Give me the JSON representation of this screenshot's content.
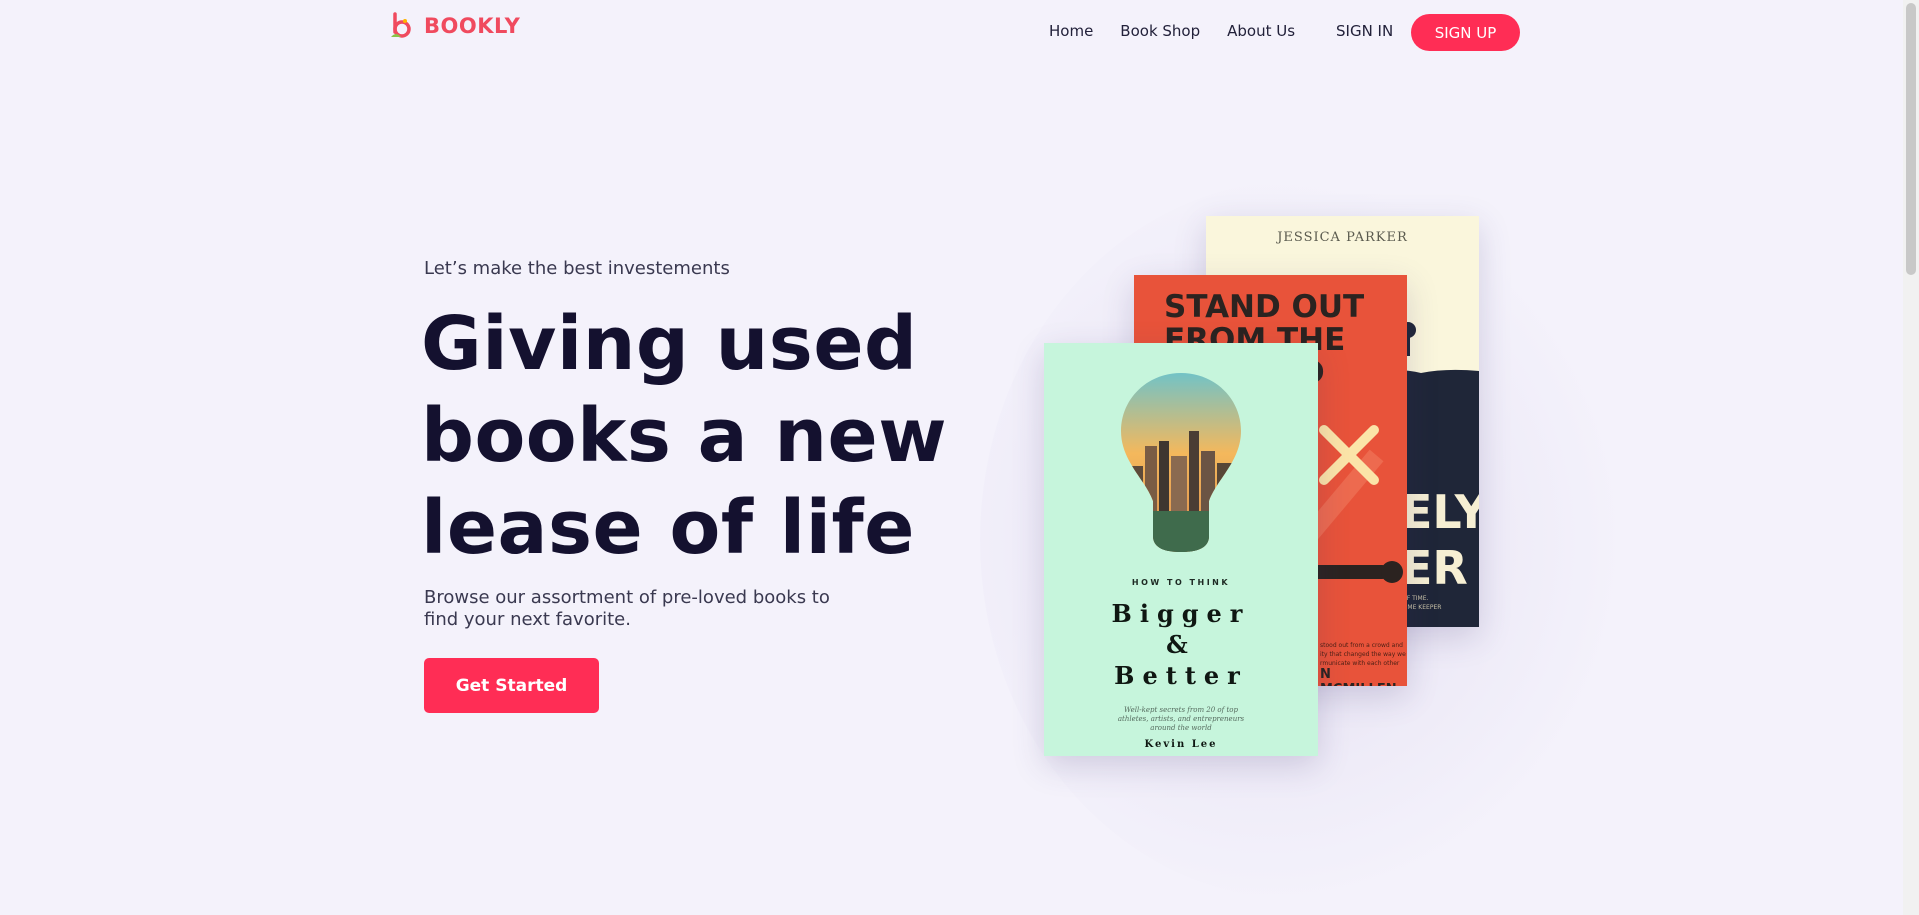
{
  "brand": {
    "name": "BOOKLY",
    "icon": "bookly-logo-icon"
  },
  "nav": {
    "links": [
      {
        "label": "Home"
      },
      {
        "label": "Book Shop"
      },
      {
        "label": "About Us"
      }
    ],
    "signin_label": "SIGN IN",
    "signup_label": "SIGN UP"
  },
  "hero": {
    "eyebrow": "Let’s make the best investements",
    "headline_lines": [
      "Giving used",
      "books a new",
      "lease of life"
    ],
    "subtext_lines": [
      "Browse our assortment of pre-loved books to",
      "find your next favorite."
    ],
    "cta_label": "Get Started"
  },
  "books": {
    "back": {
      "author": "JESSICA PARKER",
      "title_lines": [
        "ELY",
        "ER"
      ],
      "small_lines": [
        "OF TIME.",
        "TIME KEEPER"
      ]
    },
    "middle": {
      "title_lines": [
        "STAND OUT",
        "FROM THE",
        "D"
      ],
      "blurb_lines": [
        "stood out from a crowd and",
        "ity that changed the way we",
        "rmunicate with each other"
      ],
      "author": "N MCMILLEN"
    },
    "front": {
      "kicker": "HOW TO THINK",
      "title_lines": [
        "Bigger",
        "&",
        "Better"
      ],
      "tagline_lines": [
        "Well-kept secrets from 20 of top",
        "athletes, artists, and entrepreneurs",
        "around the world"
      ],
      "author": "Kevin Lee"
    }
  },
  "colors": {
    "accent": "#ff2d55",
    "brand": "#f04a5e",
    "heading": "#14112f",
    "background": "#f4f2fb"
  }
}
